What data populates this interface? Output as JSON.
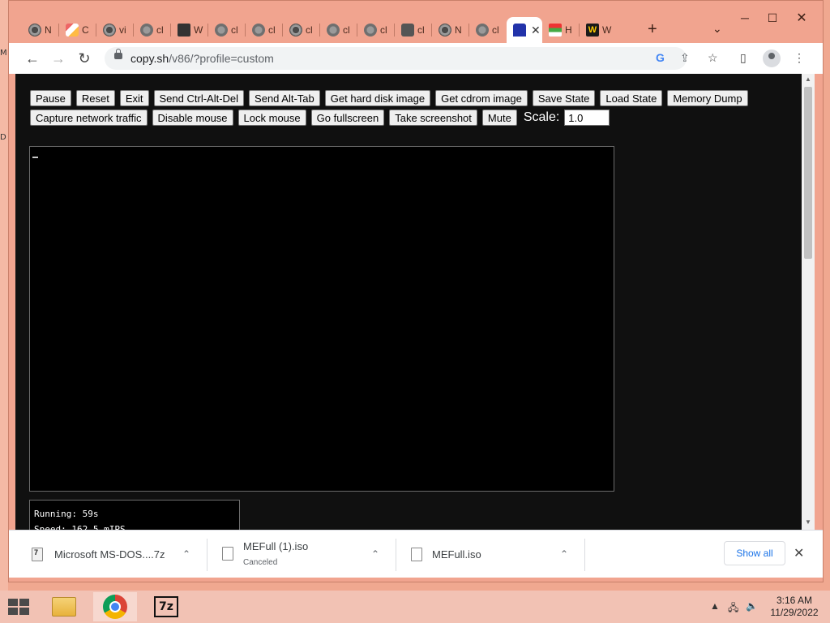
{
  "window": {
    "controls": {
      "minimize": "─",
      "maximize": "☐",
      "close": "✕"
    }
  },
  "tabs": [
    {
      "letter": "N",
      "icon": "chrome-icon"
    },
    {
      "letter": "C",
      "icon": "cc-icon"
    },
    {
      "letter": "vi",
      "icon": "chrome-icon"
    },
    {
      "letter": "cl",
      "icon": "globe-icon"
    },
    {
      "letter": "W",
      "icon": "building-icon"
    },
    {
      "letter": "cl",
      "icon": "globe-icon"
    },
    {
      "letter": "cl",
      "icon": "globe-icon"
    },
    {
      "letter": "cl",
      "icon": "chrome-icon"
    },
    {
      "letter": "cl",
      "icon": "globe-icon"
    },
    {
      "letter": "cl",
      "icon": "globe-icon"
    },
    {
      "letter": "cl",
      "icon": "puzzle-icon"
    },
    {
      "letter": "N",
      "icon": "chrome-icon"
    },
    {
      "letter": "cl",
      "icon": "globe-icon"
    },
    {
      "letter": "",
      "icon": "monster-icon",
      "active": true
    },
    {
      "letter": "H",
      "icon": "h-icon"
    },
    {
      "letter": "W",
      "icon": "w-icon"
    }
  ],
  "toolbar": {
    "url_host": "copy.sh",
    "url_path": "/v86/?profile=custom"
  },
  "emulator": {
    "buttons_row1": [
      "Pause",
      "Reset",
      "Exit",
      "Send Ctrl-Alt-Del",
      "Send Alt-Tab",
      "Get hard disk image",
      "Get cdrom image",
      "Save State",
      "Load State",
      "Memory Dump"
    ],
    "buttons_row2": [
      "Capture network traffic",
      "Disable mouse",
      "Lock mouse",
      "Go fullscreen",
      "Take screenshot",
      "Mute"
    ],
    "scale_label": "Scale:",
    "scale_value": "1.0",
    "stats": {
      "running": "Running: 59s",
      "speed": "Speed: 162.5 mIPS"
    }
  },
  "downloads": {
    "items": [
      {
        "name": "Microsoft MS-DOS....7z",
        "status": ""
      },
      {
        "name": "MEFull (1).iso",
        "status": "Canceled"
      },
      {
        "name": "MEFull.iso",
        "status": ""
      }
    ],
    "show_all": "Show all"
  },
  "taskbar": {
    "time": "3:16 AM",
    "date": "11/29/2022",
    "sevenz_label": "7z"
  },
  "desktop": {
    "edge_labels": [
      "M",
      "D"
    ]
  }
}
